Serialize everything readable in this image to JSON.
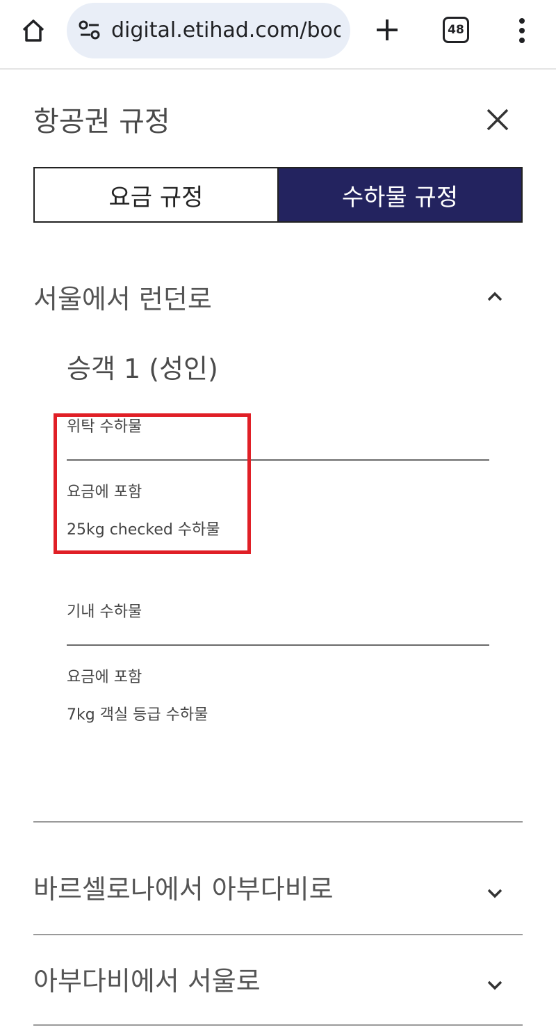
{
  "browser": {
    "url": "digital.etihad.com/booking",
    "tab_count": "48",
    "icons": [
      "home-icon",
      "site-settings-icon",
      "plus-icon",
      "tab-switcher-icon",
      "more-vert-icon"
    ]
  },
  "dialog": {
    "title": "항공권 규정",
    "close_icon": "close-icon"
  },
  "tabs": [
    {
      "label": "요금 규정",
      "selected": false
    },
    {
      "label": "수하물 규정",
      "selected": true
    }
  ],
  "colors": {
    "selected_tab_bg": "#23235f",
    "highlight_border": "#e01f26"
  },
  "segments": [
    {
      "title": "서울에서 런던로",
      "expanded": true,
      "passenger": "승객 1 (성인)",
      "checked_baggage": {
        "heading": "위탁 수하물",
        "status": "요금에 포함",
        "detail": "25kg checked 수하물"
      },
      "cabin_baggage": {
        "heading": "기내 수하물",
        "status": "요금에 포함",
        "detail": "7kg 객실 등급 수하물"
      }
    },
    {
      "title": "바르셀로나에서 아부다비로",
      "expanded": false
    },
    {
      "title": "아부다비에서 서울로",
      "expanded": false
    }
  ]
}
